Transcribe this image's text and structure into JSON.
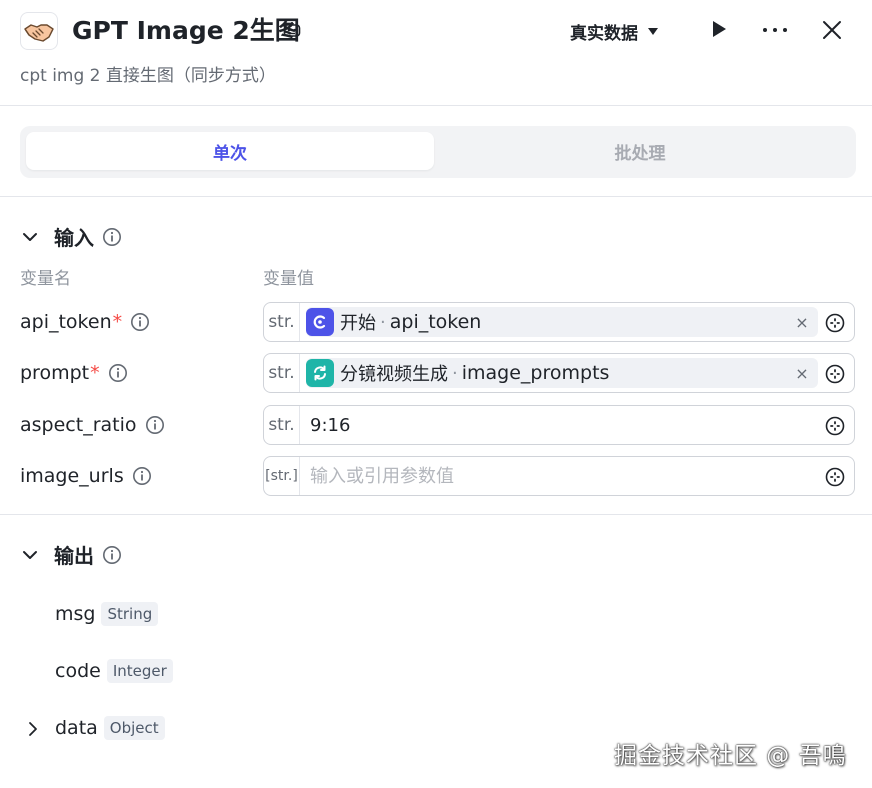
{
  "header": {
    "title": "GPT Image 2生图",
    "subtitle": "cpt img 2 直接生图（同步方式）",
    "env_label": "真实数据",
    "icons": {
      "logo": "handshake-icon",
      "robot": "robot-icon",
      "run": "play-icon",
      "more": "more-icon",
      "close": "close-icon"
    }
  },
  "tabs": [
    {
      "label": "单次",
      "active": true
    },
    {
      "label": "批处理",
      "active": false
    }
  ],
  "input_section": {
    "title": "输入",
    "col_name": "变量名",
    "col_value": "变量值",
    "rows": [
      {
        "name": "api_token",
        "required": true,
        "type": "str.",
        "kind": "ref",
        "ref_node": "开始",
        "ref_var": "api_token",
        "ref_color": "#4d53e8"
      },
      {
        "name": "prompt",
        "required": true,
        "type": "str.",
        "kind": "ref",
        "ref_node": "分镜视频生成",
        "ref_var": "image_prompts",
        "ref_color": "#1fb5a8"
      },
      {
        "name": "aspect_ratio",
        "required": false,
        "type": "str.",
        "kind": "value",
        "value": "9:16"
      },
      {
        "name": "image_urls",
        "required": false,
        "type": "[str.]",
        "kind": "input",
        "placeholder": "输入或引用参数值"
      }
    ]
  },
  "output_section": {
    "title": "输出",
    "items": [
      {
        "name": "msg",
        "type": "String"
      },
      {
        "name": "code",
        "type": "Integer"
      },
      {
        "name": "data",
        "type": "Object"
      }
    ]
  },
  "required_mark": "*",
  "chip_close": "×",
  "watermark": "掘金技术社区 @ 吾鳴",
  "colors": {
    "accent": "#4d53e8",
    "teal": "#1fb5a8",
    "required": "#f54a45"
  }
}
